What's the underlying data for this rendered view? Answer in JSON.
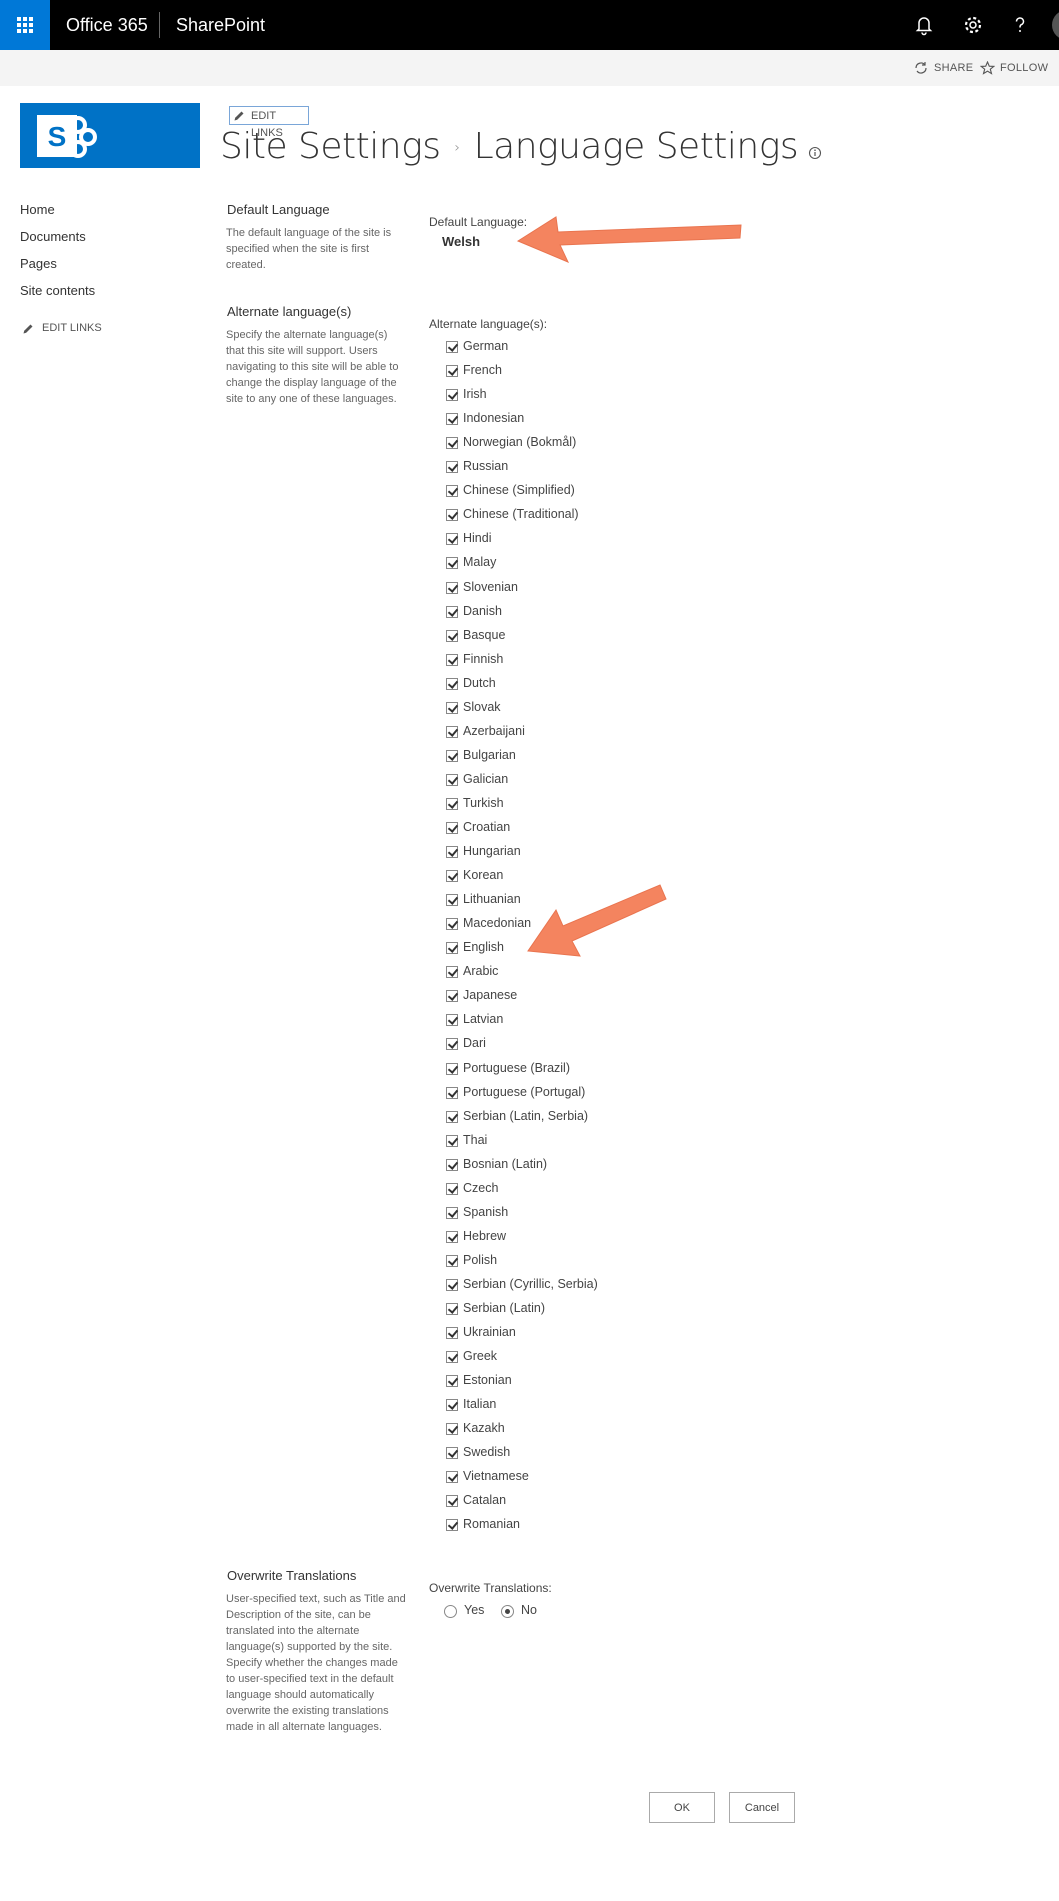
{
  "suite_bar": {
    "brand": "Office 365",
    "app": "SharePoint"
  },
  "sub_bar": {
    "share_label": "SHARE",
    "follow_label": "FOLLOW"
  },
  "logo": {
    "letter": "S",
    "color": "#0072c6"
  },
  "title_area": {
    "edit_links": "EDIT LINKS",
    "breadcrumb_parent": "Site Settings",
    "breadcrumb_current": "Language Settings"
  },
  "left_nav": {
    "items": [
      "Home",
      "Documents",
      "Pages",
      "Site contents"
    ],
    "edit_links": "EDIT LINKS"
  },
  "default_language_section": {
    "title": "Default Language",
    "description": "The default language of the site is specified when the site is first created.",
    "label": "Default Language:",
    "value": "Welsh"
  },
  "alternate_section": {
    "title": "Alternate language(s)",
    "description": "Specify the alternate language(s) that this site will support. Users navigating to this site will be able to change the display language of the site to any one of these languages.",
    "label": "Alternate language(s):",
    "languages": [
      "German",
      "French",
      "Irish",
      "Indonesian",
      "Norwegian (Bokmål)",
      "Russian",
      "Chinese (Simplified)",
      "Chinese (Traditional)",
      "Hindi",
      "Malay",
      "Slovenian",
      "Danish",
      "Basque",
      "Finnish",
      "Dutch",
      "Slovak",
      "Azerbaijani",
      "Bulgarian",
      "Galician",
      "Turkish",
      "Croatian",
      "Hungarian",
      "Korean",
      "Lithuanian",
      "Macedonian",
      "English",
      "Arabic",
      "Japanese",
      "Latvian",
      "Dari",
      "Portuguese (Brazil)",
      "Portuguese (Portugal)",
      "Serbian (Latin, Serbia)",
      "Thai",
      "Bosnian (Latin)",
      "Czech",
      "Spanish",
      "Hebrew",
      "Polish",
      "Serbian (Cyrillic, Serbia)",
      "Serbian (Latin)",
      "Ukrainian",
      "Greek",
      "Estonian",
      "Italian",
      "Kazakh",
      "Swedish",
      "Vietnamese",
      "Catalan",
      "Romanian"
    ],
    "all_checked": true
  },
  "overwrite_section": {
    "title": "Overwrite Translations",
    "description": "User-specified text, such as Title and Description of the site, can be translated into the alternate language(s) supported by the site. Specify whether the changes made to user-specified text in the default language should automatically overwrite the existing translations made in all alternate languages.",
    "label": "Overwrite Translations:",
    "yes_label": "Yes",
    "no_label": "No",
    "selected": "No"
  },
  "buttons": {
    "ok": "OK",
    "cancel": "Cancel"
  },
  "colors": {
    "suite_bar": "#000000",
    "waffle": "#0078d7",
    "logo": "#0072c6",
    "annotation_arrow": "#f4845f"
  }
}
